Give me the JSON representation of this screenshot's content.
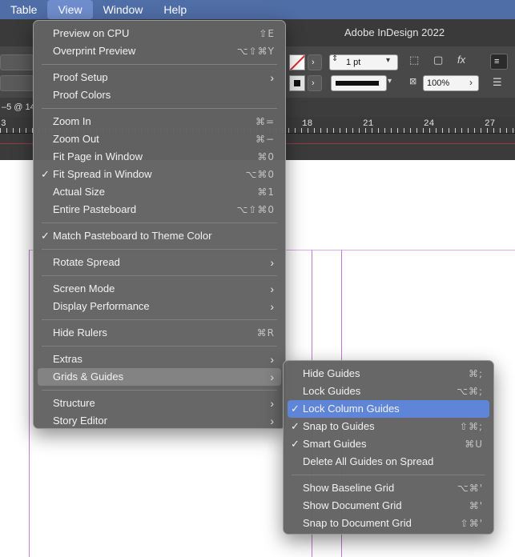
{
  "menubar": {
    "items": [
      {
        "label": "Table"
      },
      {
        "label": "View"
      },
      {
        "label": "Window"
      },
      {
        "label": "Help"
      }
    ]
  },
  "app": {
    "title": "Adobe InDesign 2022",
    "doc_tab": "–5 @ 14",
    "stroke_weight": "1 pt",
    "opacity": "100%"
  },
  "ruler": {
    "numbers": [
      "3",
      "18",
      "21",
      "24",
      "27"
    ]
  },
  "view_menu": {
    "preview_cpu": {
      "label": "Preview on CPU",
      "shortcut": "⇧E"
    },
    "overprint": {
      "label": "Overprint Preview",
      "shortcut": "⌥⇧⌘Y"
    },
    "proof_setup": {
      "label": "Proof Setup"
    },
    "proof_colors": {
      "label": "Proof Colors"
    },
    "zoom_in": {
      "label": "Zoom In",
      "shortcut": "⌘="
    },
    "zoom_out": {
      "label": "Zoom Out",
      "shortcut": "⌘−"
    },
    "fit_page": {
      "label": "Fit Page in Window",
      "shortcut": "⌘0"
    },
    "fit_spread": {
      "label": "Fit Spread in Window",
      "shortcut": "⌥⌘0",
      "checked": "✓"
    },
    "actual_size": {
      "label": "Actual Size",
      "shortcut": "⌘1"
    },
    "entire_pasteboard": {
      "label": "Entire Pasteboard",
      "shortcut": "⌥⇧⌘0"
    },
    "match_pasteboard": {
      "label": "Match Pasteboard to Theme Color",
      "checked": "✓"
    },
    "rotate_spread": {
      "label": "Rotate Spread"
    },
    "screen_mode": {
      "label": "Screen Mode"
    },
    "display_performance": {
      "label": "Display Performance"
    },
    "hide_rulers": {
      "label": "Hide Rulers",
      "shortcut": "⌘R"
    },
    "extras": {
      "label": "Extras"
    },
    "grids_guides": {
      "label": "Grids & Guides"
    },
    "structure": {
      "label": "Structure"
    },
    "story_editor": {
      "label": "Story Editor"
    }
  },
  "grids_menu": {
    "hide_guides": {
      "label": "Hide Guides",
      "shortcut": "⌘;"
    },
    "lock_guides": {
      "label": "Lock Guides",
      "shortcut": "⌥⌘;"
    },
    "lock_column_guides": {
      "label": "Lock Column Guides",
      "checked": "✓"
    },
    "snap_to_guides": {
      "label": "Snap to Guides",
      "shortcut": "⇧⌘;",
      "checked": "✓"
    },
    "smart_guides": {
      "label": "Smart Guides",
      "shortcut": "⌘U",
      "checked": "✓"
    },
    "delete_all_guides": {
      "label": "Delete All Guides on Spread"
    },
    "show_baseline_grid": {
      "label": "Show Baseline Grid",
      "shortcut": "⌥⌘'"
    },
    "show_document_grid": {
      "label": "Show Document Grid",
      "shortcut": "⌘'"
    },
    "snap_document_grid": {
      "label": "Snap to Document Grid",
      "shortcut": "⇧⌘'"
    }
  },
  "icons": {
    "submenu": "chevron-right-icon",
    "check": "checkmark-icon"
  },
  "colors": {
    "menubar": "#4f6da6",
    "selection": "#5f85d8",
    "guide": "#c07bd6"
  }
}
